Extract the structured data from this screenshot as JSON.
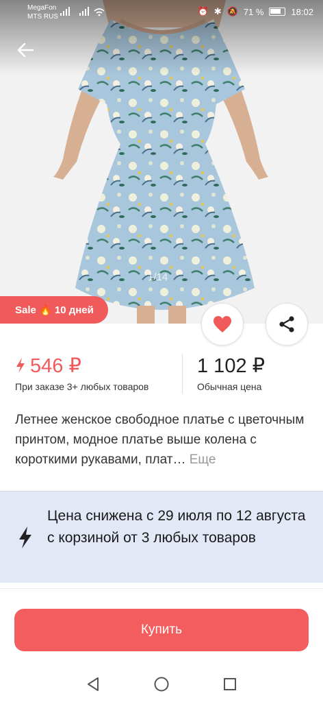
{
  "status_bar": {
    "carrier_1": "MegaFon",
    "carrier_2": "MTS RUS",
    "battery_percent": "71 %",
    "time": "18:02"
  },
  "product_gallery": {
    "counter": "1/14",
    "dress_colors": {
      "base": "#a9c7dc",
      "flowers": "#eef0dc",
      "leaves": "#3f7f6b",
      "accent": "#d9c86a"
    }
  },
  "sale_badge": {
    "text": "Sale 🔥 10 дней"
  },
  "pricing": {
    "sale_price": "546 ₽",
    "sale_price_note": "При заказе 3+ любых товаров",
    "regular_price": "1 102 ₽",
    "regular_price_note": "Обычная цена"
  },
  "description": {
    "text": "Летнее женское свободное платье с цветочным принтом, модное платье выше колена с короткими рукавами, плат…",
    "more_label": "Еще"
  },
  "promo": {
    "text": "Цена снижена с 29 июля по 12 августа с корзиной от 3 любых товаров"
  },
  "buy_button": {
    "label": "Купить"
  },
  "colors": {
    "accent": "#f35d5d",
    "promo_bg": "#e3e8f6"
  },
  "icons": {
    "back": "arrow-left",
    "favorite": "heart",
    "share": "share",
    "lightning": "bolt"
  }
}
